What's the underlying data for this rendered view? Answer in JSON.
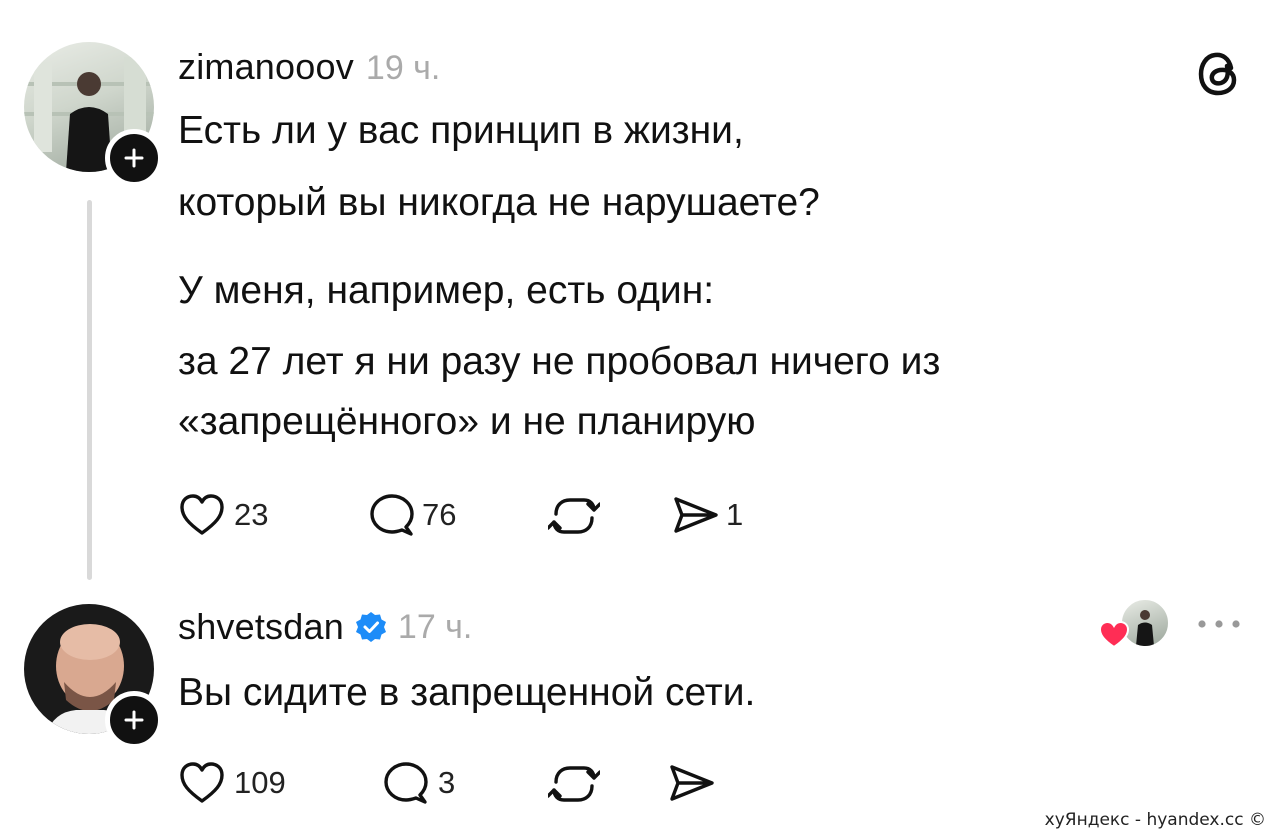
{
  "post": {
    "username": "zimanooov",
    "time": "19 ч.",
    "lines": [
      "Есть ли у вас принцип в жизни,",
      "который вы никогда не нарушаете?",
      "У меня, например, есть один:",
      "за 27 лет я ни разу не пробовал ничего из",
      "«запрещённого» и не планирую"
    ],
    "likes": "23",
    "comments": "76",
    "shares": "1"
  },
  "reply": {
    "username": "shvetsdan",
    "time": "17 ч.",
    "text": "Вы сидите в запрещенной сети.",
    "likes": "109",
    "comments": "3"
  },
  "watermark": "хуЯндекс - hyandex.cc ©",
  "colors": {
    "verified": "#1d8cf8",
    "heart": "#ff2d55",
    "muted": "#aaaaaa",
    "thread_line": "#d9d9d9"
  },
  "icons": [
    "threads-logo-icon",
    "heart-icon",
    "comment-icon",
    "repost-icon",
    "send-icon",
    "verified-icon",
    "more-icon",
    "plus-icon"
  ]
}
